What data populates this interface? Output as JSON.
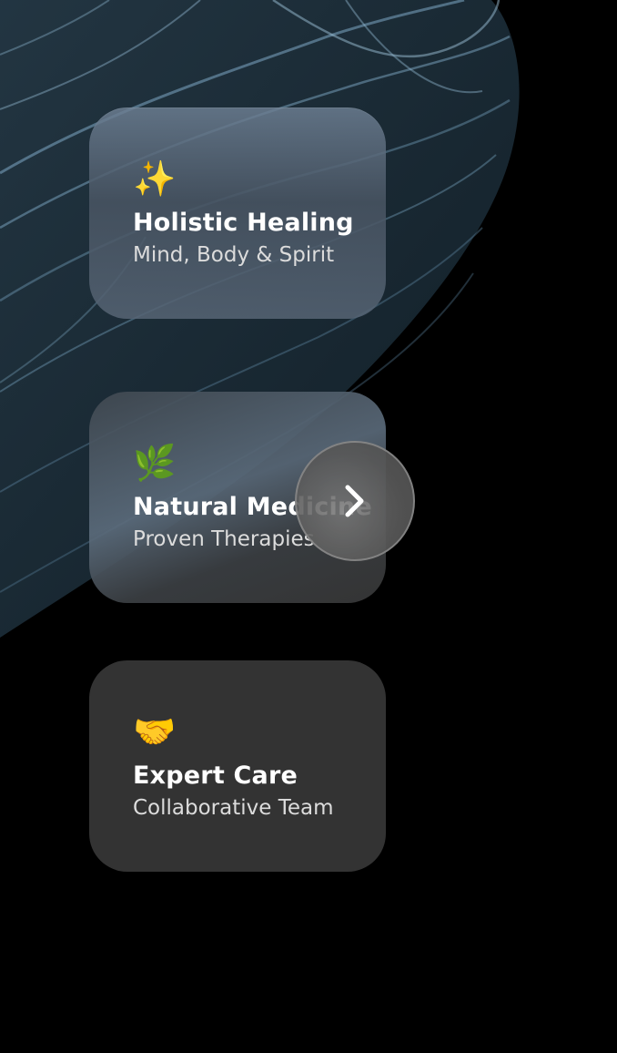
{
  "colors": {
    "background": "#000000",
    "card_dark": "#333333",
    "text_primary": "#ffffff",
    "text_secondary": "#dcdcdc"
  },
  "background_art": "anatomy-xray-illustration",
  "cards": [
    {
      "icon": "✨",
      "icon_name": "sparkles-icon",
      "title": "Holistic Healing",
      "subtitle": "Mind, Body & Spirit"
    },
    {
      "icon": "🌿",
      "icon_name": "herb-icon",
      "title": "Natural Medicine",
      "subtitle": "Proven Therapies"
    },
    {
      "icon": "🤝",
      "icon_name": "handshake-icon",
      "title": "Expert Care",
      "subtitle": "Collaborative Team"
    }
  ],
  "next_button": {
    "icon_name": "chevron-right-icon"
  }
}
